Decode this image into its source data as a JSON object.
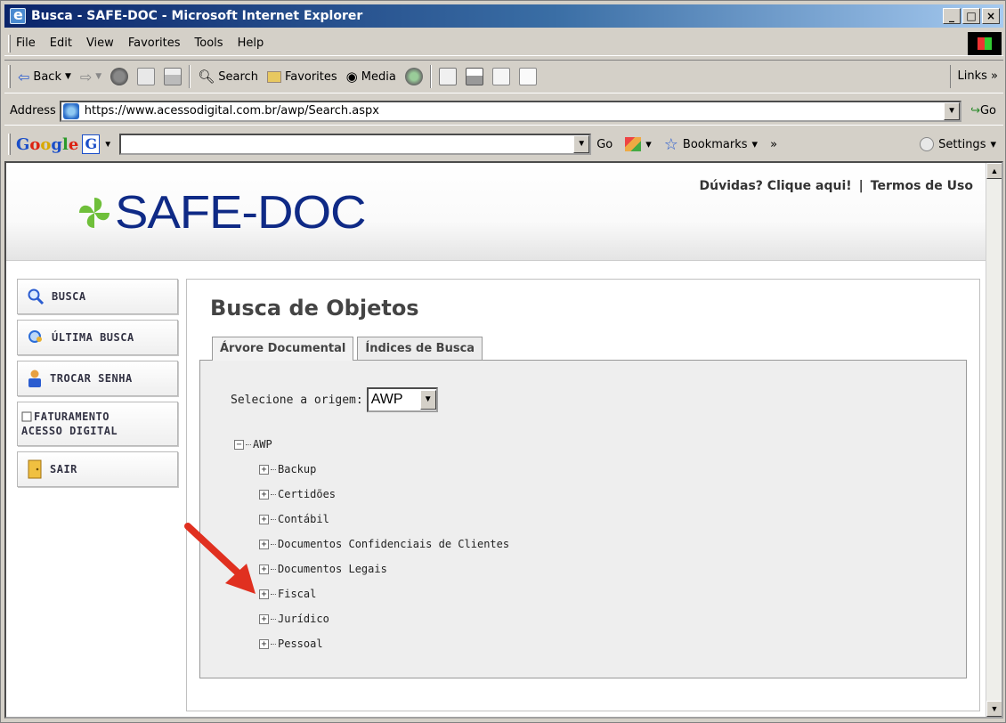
{
  "window": {
    "title": "Busca - SAFE-DOC - Microsoft Internet Explorer"
  },
  "menu": [
    "File",
    "Edit",
    "View",
    "Favorites",
    "Tools",
    "Help"
  ],
  "toolbar": {
    "back": "Back",
    "search": "Search",
    "favorites": "Favorites",
    "media": "Media",
    "links": "Links"
  },
  "address": {
    "label": "Address",
    "url": "https://www.acessodigital.com.br/awp/Search.aspx",
    "go": "Go"
  },
  "googlebar": {
    "go": "Go",
    "bookmarks": "Bookmarks",
    "settings": "Settings"
  },
  "site": {
    "logo": "SAFE-DOC",
    "help_link": "Dúvidas? Clique aqui!",
    "terms_link": "Termos de Uso"
  },
  "sidebar": [
    {
      "label": "BUSCA"
    },
    {
      "label": "ÚLTIMA BUSCA"
    },
    {
      "label": "TROCAR SENHA"
    },
    {
      "line1": "FATURAMENTO",
      "line2": "ACESSO DIGITAL"
    },
    {
      "label": "SAIR"
    }
  ],
  "main": {
    "title": "Busca de Objetos",
    "tabs": [
      "Árvore Documental",
      "Índices de Busca"
    ],
    "origin_label": "Selecione a origem:",
    "origin_value": "AWP",
    "tree_root": "AWP",
    "tree_children": [
      "Backup",
      "Certidões",
      "Contábil",
      "Documentos Confidenciais de Clientes",
      "Documentos Legais",
      "Fiscal",
      "Jurídico",
      "Pessoal"
    ]
  },
  "colors": {
    "title_bar": "#0a246a",
    "logo_text": "#0f2a86",
    "logo_mark": "#6fbf3a",
    "arrow": "#e03020"
  }
}
